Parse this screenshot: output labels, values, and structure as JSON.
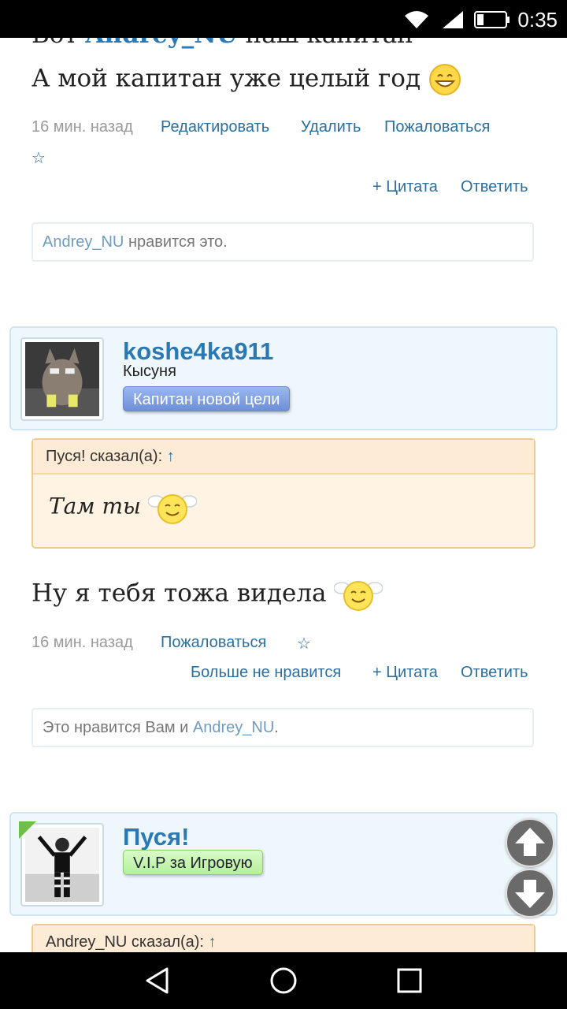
{
  "status_bar": {
    "time": "0:35",
    "icons": [
      "wifi-icon",
      "signal-icon",
      "battery-icon"
    ]
  },
  "post1": {
    "line1_prefix": "Вот",
    "line1_user": "Andrey_NU",
    "line1_suffix": "наш капитан",
    "line2": "А мой капитан уже целый год",
    "time": "16 мин. назад",
    "edit": "Редактировать",
    "delete": "Удалить",
    "report": "Пожаловаться",
    "star": "☆",
    "quote_action": "+ Цитата",
    "reply": "Ответить",
    "likes_user": "Andrey_NU",
    "likes_text": " нравится это."
  },
  "post2": {
    "username": "koshe4ka911",
    "user_title": "Кысуня",
    "badge": "Капитан новой цели",
    "quote_head": "Пуся! сказал(а):",
    "quote_arrow": "↑",
    "quote_text": "Там ты",
    "message": "Ну я тебя тожа видела",
    "time": "16 мин. назад",
    "report": "Пожаловаться",
    "star": "☆",
    "unlike": "Больше не нравится",
    "quote_action": "+ Цитата",
    "reply": "Ответить",
    "likes_prefix": "Это нравится Вам и ",
    "likes_user": "Andrey_NU",
    "likes_suffix": "."
  },
  "post3": {
    "username": "Пуся!",
    "badge": "V.I.P за Игровую",
    "quote_head": "Andrey_NU сказал(а):",
    "quote_arrow": "↑"
  },
  "colors": {
    "link": "#2a6fa0",
    "username": "#2a78b4",
    "quote_border": "#f3c98e",
    "userbar_bg": "#eef7fc"
  }
}
